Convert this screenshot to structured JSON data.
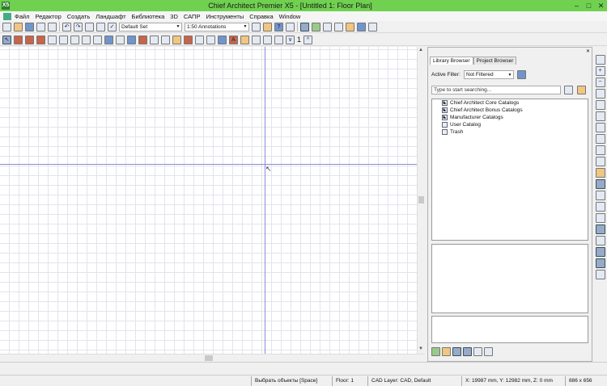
{
  "window": {
    "title": "Chief Architect Premier X5 - [Untitled 1: Floor Plan]",
    "app_icon": "X5",
    "minimize": "–",
    "maximize": "□",
    "close": "✕"
  },
  "menu": [
    "Файл",
    "Редактор",
    "Создать",
    "Ландшафт",
    "Библиотека",
    "3D",
    "САПР",
    "Инструменты",
    "Справка",
    "Window"
  ],
  "toolbar": {
    "layer_set": "Default Set",
    "annotation_set": "1:50 Annotations",
    "item_count": "1"
  },
  "panel": {
    "tabs": [
      "Library Browser",
      "Project Browser"
    ],
    "filter_label": "Active Filter:",
    "filter_value": "Not Filtered",
    "search_placeholder": "Type to start searching...",
    "tree": [
      "Chief Architect Core Catalogs",
      "Chief Architect Bonus Catalogs",
      "Manufacturer Catalogs",
      "User Catalog",
      "Trash"
    ],
    "close": "✕"
  },
  "status": {
    "tool": "Выбрать объекты [Space]",
    "floor": "Floor: 1",
    "layer": "CAD Layer: CAD,  Default",
    "coords": "X: 19987 mm, Y: 12982 mm, Z: 0 mm",
    "size": "886 x 656"
  }
}
